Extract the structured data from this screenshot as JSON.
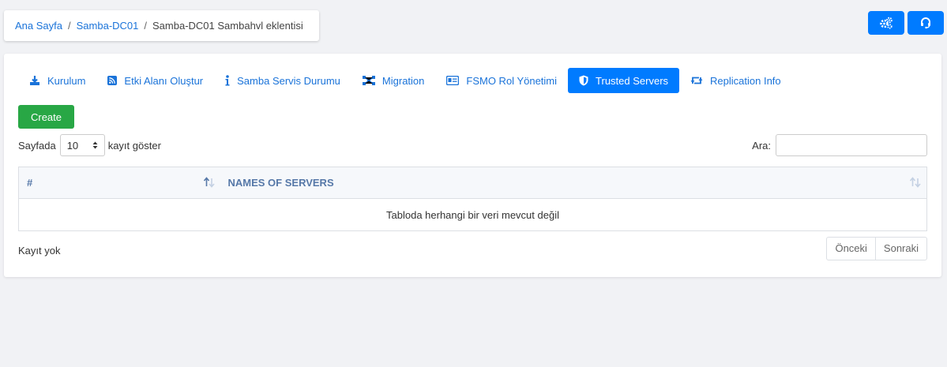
{
  "breadcrumb": {
    "home": "Ana Sayfa",
    "server": "Samba-DC01",
    "current": "Samba-DC01 Sambahvl eklentisi"
  },
  "toolbar": {
    "settings_icon": "gears-icon",
    "support_icon": "headset-icon"
  },
  "tabs": [
    {
      "label": "Kurulum",
      "icon": "download-icon"
    },
    {
      "label": "Etki Alanı Oluştur",
      "icon": "rss-icon"
    },
    {
      "label": "Samba Servis Durumu",
      "icon": "info-icon"
    },
    {
      "label": "Migration",
      "icon": "nodes-icon"
    },
    {
      "label": "FSMO Rol Yönetimi",
      "icon": "id-card-icon"
    },
    {
      "label": "Trusted Servers",
      "icon": "shield-icon"
    },
    {
      "label": "Replication Info",
      "icon": "retweet-icon"
    }
  ],
  "active_tab": "Trusted Servers",
  "create_label": "Create",
  "length": {
    "prefix": "Sayfada",
    "value": "10",
    "suffix": "kayıt göster"
  },
  "search": {
    "label": "Ara:",
    "value": ""
  },
  "table": {
    "columns": [
      "#",
      "NAMES OF SERVERS"
    ],
    "empty_message": "Tabloda herhangi bir veri mevcut değil"
  },
  "info_text": "Kayıt yok",
  "pagination": {
    "prev": "Önceki",
    "next": "Sonraki"
  },
  "colors": {
    "primary": "#007bff",
    "success": "#28a745",
    "link": "#1a73d9"
  }
}
